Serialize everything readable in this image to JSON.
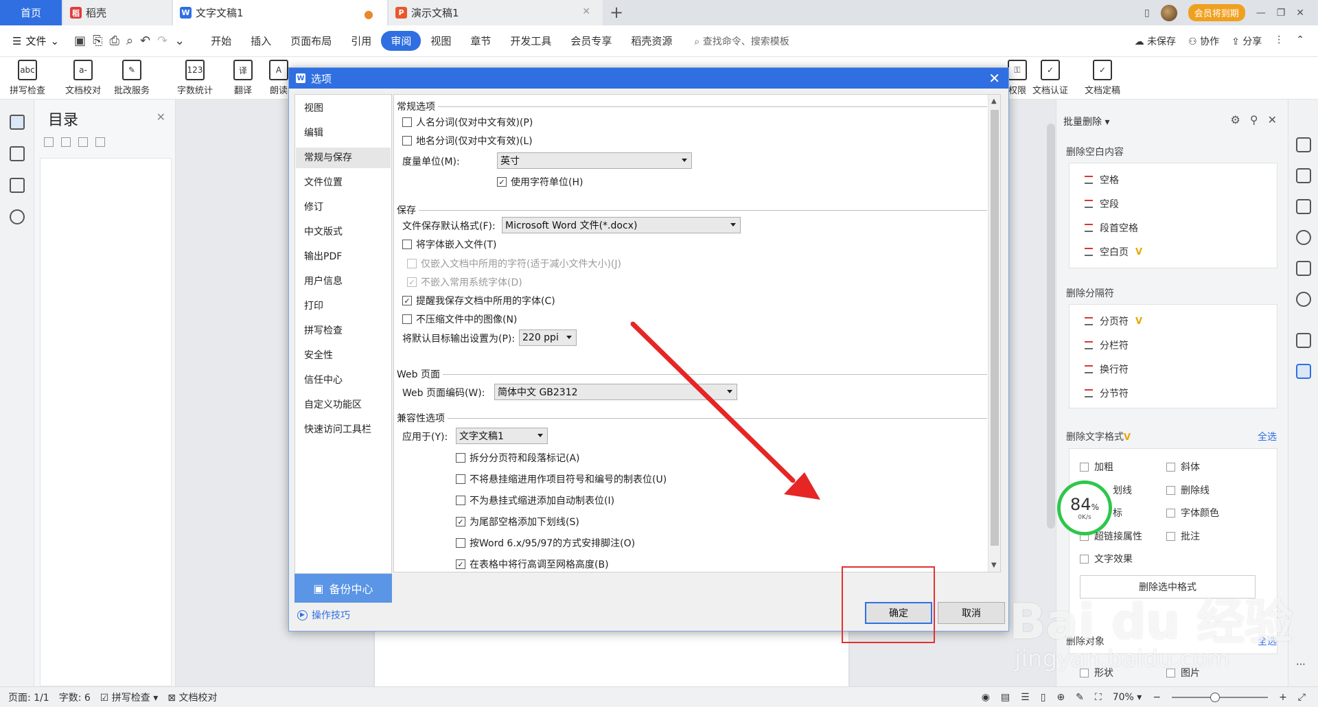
{
  "tabs": {
    "home": "首页",
    "docer": "稻壳",
    "doc": "文字文稿1",
    "ppt": "演示文稿1"
  },
  "top_right": {
    "vip": "会员将到期"
  },
  "menubar": {
    "file": "文件",
    "items": [
      "开始",
      "插入",
      "页面布局",
      "引用",
      "审阅",
      "视图",
      "章节",
      "开发工具",
      "会员专享",
      "稻壳资源"
    ],
    "search": "查找命令、搜索模板",
    "unsaved": "未保存",
    "collab": "协作",
    "share": "分享"
  },
  "ribbon": {
    "spell": "拼写检查",
    "proofread": "文档校对",
    "review_service": "批改服务",
    "word_count": "字数统计",
    "translate": "翻译",
    "read": "朗读",
    "permission": "权限",
    "certify": "文档认证",
    "finalize": "文档定稿"
  },
  "toc": {
    "title": "目录"
  },
  "right_pane": {
    "header": "批量删除",
    "sec_blank": "删除空白内容",
    "blank_items": [
      "空格",
      "空段",
      "段首空格",
      "空白页"
    ],
    "sec_sep": "删除分隔符",
    "sep_items": [
      "分页符",
      "分栏符",
      "换行符",
      "分节符"
    ],
    "sec_format": "删除文字格式",
    "select_all": "全选",
    "format_col1": [
      "加粗",
      "划线",
      "标",
      "超链接属性",
      "文字效果"
    ],
    "format_col2": [
      "斜体",
      "删除线",
      "字体颜色",
      "批注"
    ],
    "clear_btn": "删除选中格式",
    "sec_obj": "删除对象",
    "select_all2": "全选",
    "obj_items": [
      "形状",
      "图片"
    ],
    "speed_pct": "84",
    "speed_rate": "0K/s"
  },
  "statusbar": {
    "page": "页面: 1/1",
    "words": "字数: 6",
    "spell": "拼写检查",
    "proof": "文档校对",
    "zoom": "70%"
  },
  "dialog": {
    "title": "选项",
    "nav": [
      "视图",
      "编辑",
      "常规与保存",
      "文件位置",
      "修订",
      "中文版式",
      "输出PDF",
      "用户信息",
      "打印",
      "拼写检查",
      "安全性",
      "信任中心",
      "自定义功能区",
      "快速访问工具栏"
    ],
    "backup": "备份中心",
    "tips": "操作技巧",
    "groups": {
      "general": "常规选项",
      "save": "保存",
      "web": "Web 页面",
      "compat": "兼容性选项"
    },
    "general": {
      "person_seg": "人名分词(仅对中文有效)(P)",
      "place_seg": "地名分词(仅对中文有效)(L)",
      "unit_label": "度量单位(M):",
      "unit_value": "英寸",
      "use_char_unit": "使用字符单位(H)"
    },
    "save": {
      "format_label": "文件保存默认格式(F):",
      "format_value": "Microsoft Word 文件(*.docx)",
      "embed_fonts": "将字体嵌入文件(T)",
      "embed_used": "仅嵌入文档中所用的字符(适于减小文件大小)(J)",
      "no_common": "不嵌入常用系统字体(D)",
      "remind_fonts": "提醒我保存文档中所用的字体(C)",
      "no_compress": "不压缩文件中的图像(N)",
      "ppi_label": "将默认目标输出设置为(P):",
      "ppi_value": "220 ppi"
    },
    "web": {
      "encoding_label": "Web 页面编码(W):",
      "encoding_value": "简体中文 GB2312"
    },
    "compat": {
      "apply_label": "应用于(Y):",
      "apply_value": "文字文稿1",
      "opt1": "拆分分页符和段落标记(A)",
      "opt2": "不将悬挂缩进用作项目符号和编号的制表位(U)",
      "opt3": "不为悬挂式缩进添加自动制表位(I)",
      "opt4": "为尾部空格添加下划线(S)",
      "opt5": "按Word 6.x/95/97的方式安排脚注(O)",
      "opt6": "在表格中将行高调至网格高度(B)"
    },
    "ok": "确定",
    "cancel": "取消"
  },
  "watermark": {
    "brand": "Bai du 经验",
    "url": "jingyan.baidu.com"
  }
}
